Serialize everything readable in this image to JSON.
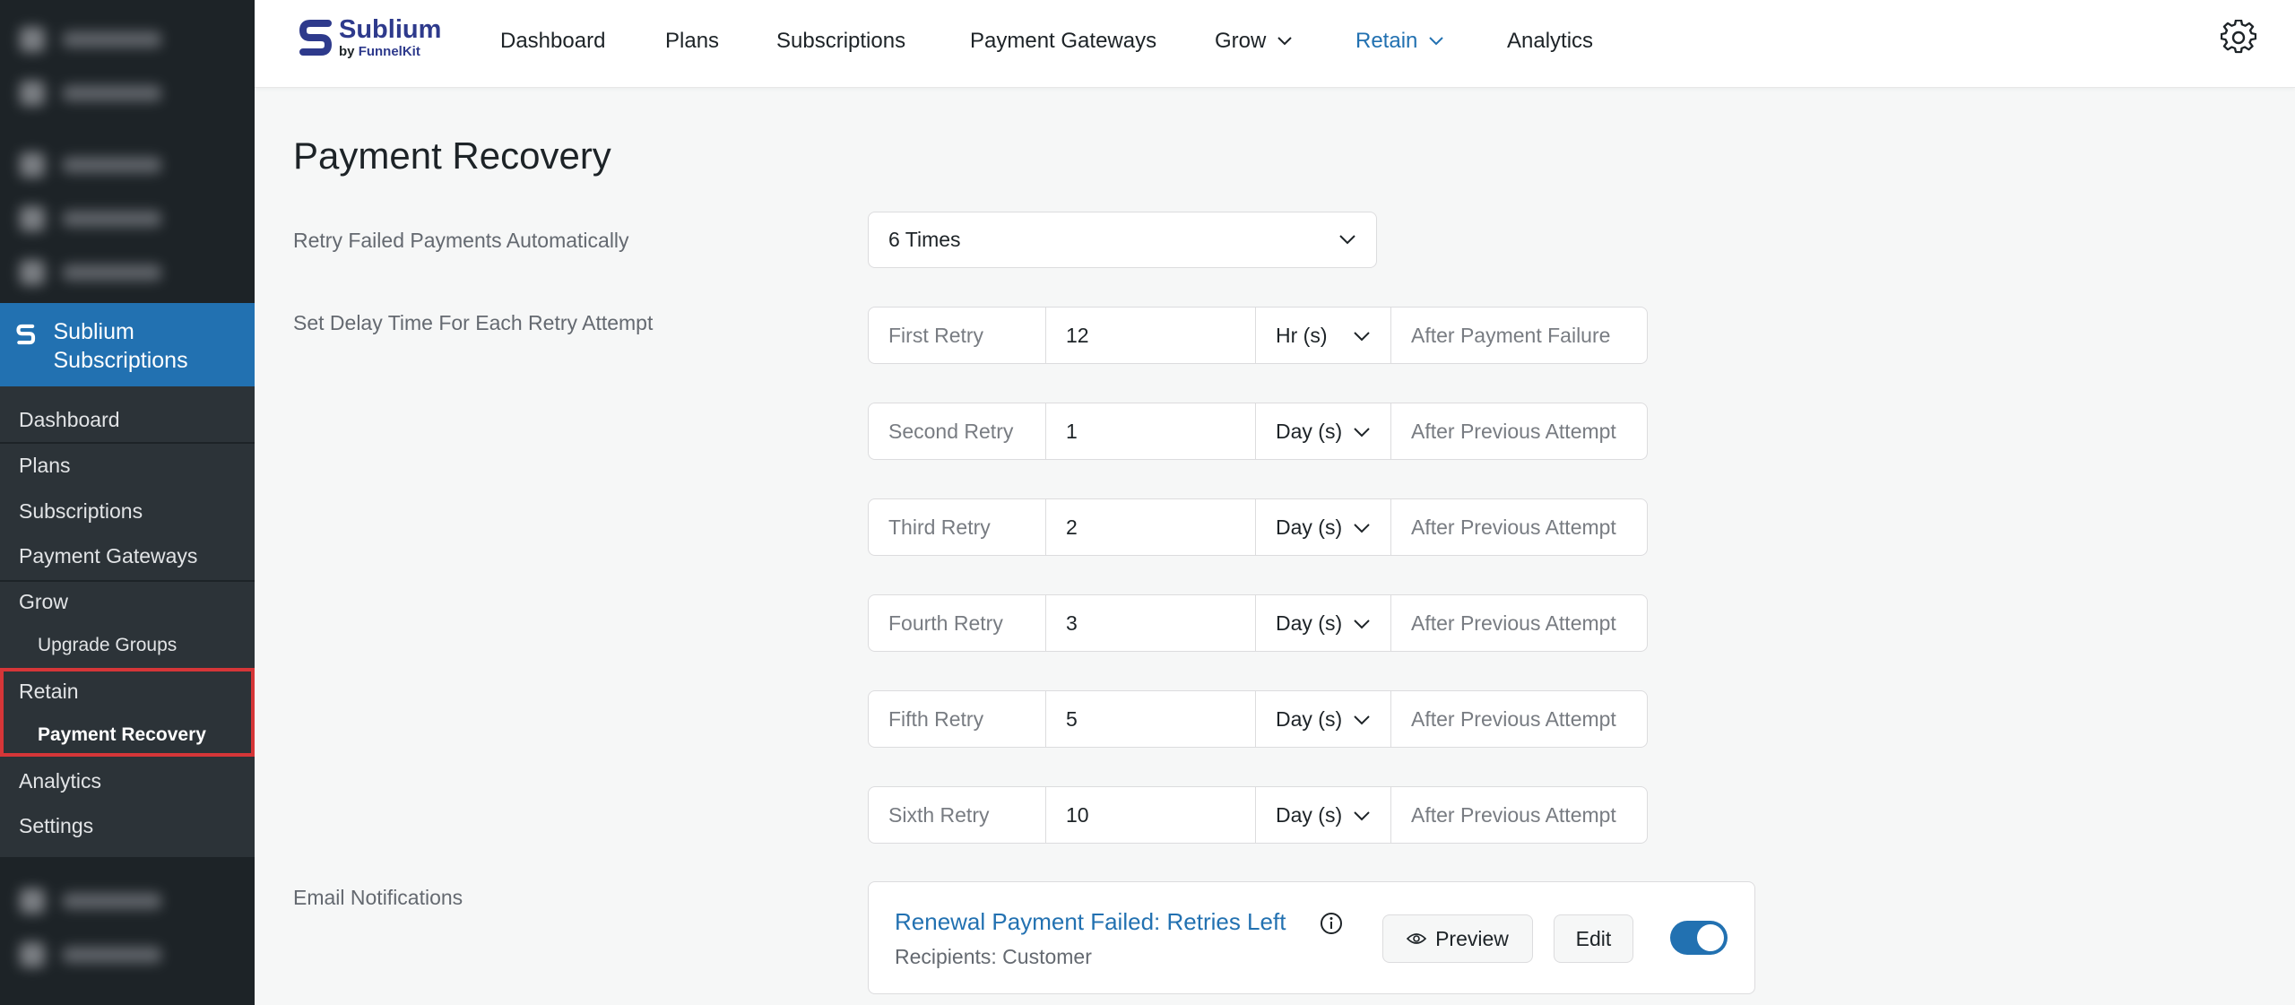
{
  "top_nav": {
    "brand_name": "Sublium",
    "brand_by": "by ",
    "brand_by_company": "FunnelKit",
    "items": [
      {
        "label": "Dashboard"
      },
      {
        "label": "Plans"
      },
      {
        "label": "Subscriptions"
      },
      {
        "label": "Payment Gateways"
      },
      {
        "label": "Grow",
        "has_dropdown": true
      },
      {
        "label": "Retain",
        "has_dropdown": true,
        "active": true
      },
      {
        "label": "Analytics"
      }
    ],
    "settings_icon": "gear-icon"
  },
  "sidebar": {
    "plugin_title": "Sublium Subscriptions",
    "items": [
      {
        "label": "Dashboard"
      },
      {
        "label": "Plans"
      },
      {
        "label": "Subscriptions"
      },
      {
        "label": "Payment Gateways"
      },
      {
        "label": "Grow"
      },
      {
        "label": "Upgrade Groups"
      },
      {
        "label": "Retain"
      },
      {
        "label": "Payment Recovery",
        "current": true
      },
      {
        "label": "Analytics"
      },
      {
        "label": "Settings"
      }
    ],
    "highlight_color": "#d63638"
  },
  "main": {
    "page_title": "Payment Recovery",
    "retry_label": "Retry Failed Payments Automatically",
    "retry_count": "6 Times",
    "delay_label": "Set Delay Time For Each Retry Attempt",
    "retries": [
      {
        "label": "First Retry",
        "value": "12",
        "unit": "Hr (s)",
        "after": "After Payment Failure"
      },
      {
        "label": "Second Retry",
        "value": "1",
        "unit": "Day (s)",
        "after": "After Previous Attempt"
      },
      {
        "label": "Third Retry",
        "value": "2",
        "unit": "Day (s)",
        "after": "After Previous Attempt"
      },
      {
        "label": "Fourth Retry",
        "value": "3",
        "unit": "Day (s)",
        "after": "After Previous Attempt"
      },
      {
        "label": "Fifth Retry",
        "value": "5",
        "unit": "Day (s)",
        "after": "After Previous Attempt"
      },
      {
        "label": "Sixth Retry",
        "value": "10",
        "unit": "Day (s)",
        "after": "After Previous Attempt"
      }
    ],
    "email_label": "Email Notifications",
    "email": {
      "title": "Renewal Payment Failed: Retries Left",
      "recipients": "Recipients: Customer",
      "preview_label": "Preview",
      "edit_label": "Edit",
      "enabled": true
    }
  },
  "colors": {
    "accent": "#2271b1",
    "sidebar_bg": "#1d2327",
    "submenu_bg": "#2c3338",
    "brand": "#2e3a8c"
  }
}
